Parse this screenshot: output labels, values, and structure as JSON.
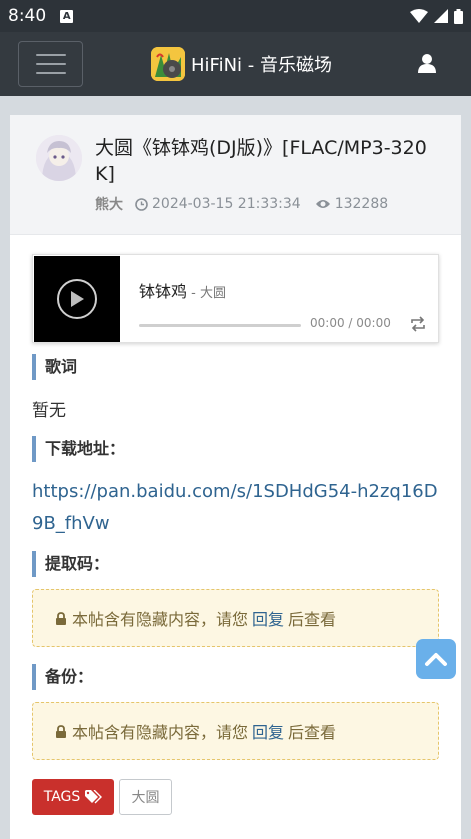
{
  "status_bar": {
    "time": "8:40",
    "notification_glyph": "A"
  },
  "navbar": {
    "site_title": "HiFiNi - 音乐磁场",
    "menu_icon": "hamburger-icon",
    "user_icon": "user-icon"
  },
  "post": {
    "title": "大圆《钵钵鸡(DJ版)》[FLAC/MP3-320K]",
    "author": "熊大",
    "datetime": "2024-03-15 21:33:34",
    "views": "132288"
  },
  "player": {
    "track": "钵钵鸡",
    "artist_prefix": " - ",
    "artist": "大圆",
    "time": "00:00 / 00:00",
    "progress": 0
  },
  "sections": {
    "lyrics_label": "歌词",
    "lyrics_text": "暂无",
    "download_label": "下载地址：",
    "download_url": "https://pan.baidu.com/s/1SDHdG54-h2zq16D9B_fhVw",
    "code_label": "提取码：",
    "backup_label": "备份："
  },
  "hidden_notice": {
    "before": "本帖含有隐藏内容，请您",
    "reply": "回复",
    "after": "后查看"
  },
  "tags": {
    "label": "TAGS",
    "items": [
      "大圆"
    ]
  },
  "colors": {
    "navbar": "#343a40",
    "accent_blue": "#6f99c6",
    "tags_red": "#c9302c",
    "link": "#2f6490"
  }
}
